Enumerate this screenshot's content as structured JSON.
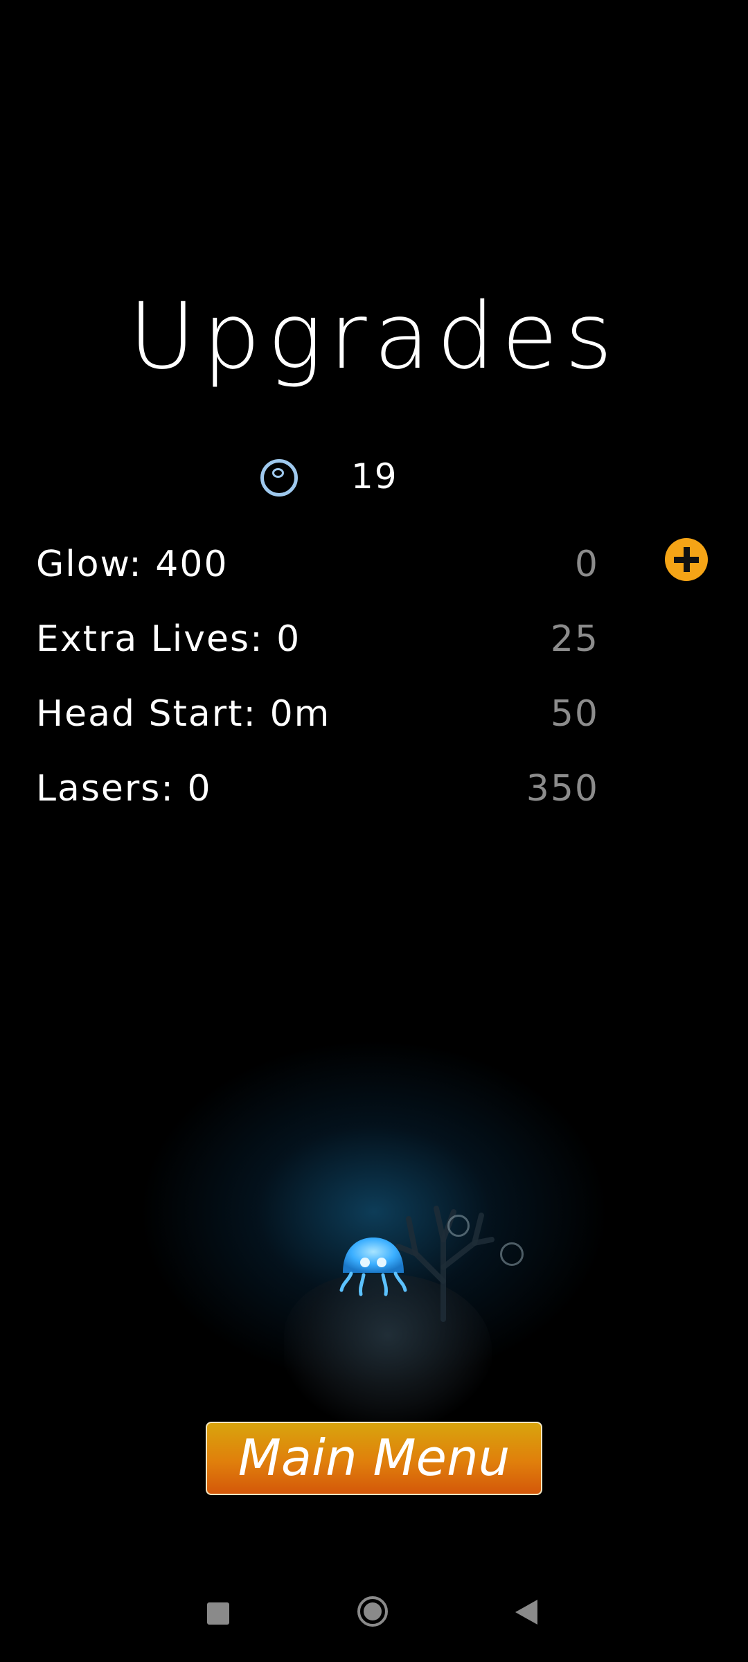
{
  "screen": {
    "title": "Upgrades"
  },
  "currency": {
    "icon": "bubble-icon",
    "count": "19"
  },
  "upgrades": [
    {
      "label": "Glow: 400",
      "cost": "0",
      "has_buy_button": true
    },
    {
      "label": "Extra Lives: 0",
      "cost": "25",
      "has_buy_button": false
    },
    {
      "label": "Head Start: 0m",
      "cost": "50",
      "has_buy_button": false
    },
    {
      "label": "Lasers: 0",
      "cost": "350",
      "has_buy_button": false
    }
  ],
  "buttons": {
    "main_menu": "Main Menu"
  },
  "colors": {
    "background": "#000000",
    "accent_orange": "#f5a416",
    "cost_gray": "#8c8c8c",
    "jelly_glow": "#2aa7ff"
  },
  "navbar": {
    "icons": [
      "recents-square-icon",
      "home-circle-icon",
      "back-triangle-icon"
    ]
  }
}
